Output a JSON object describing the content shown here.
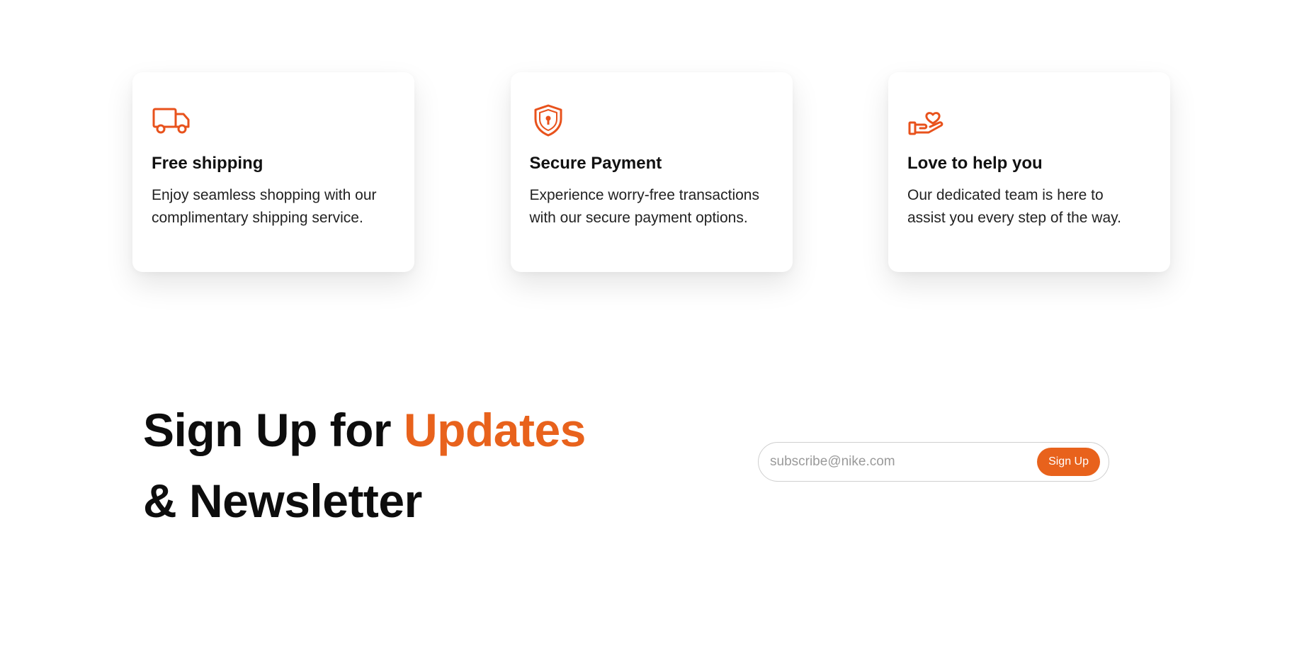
{
  "theme": {
    "accent_color": "#e8621c",
    "text_color": "#111111",
    "background": "#ffffff"
  },
  "services": [
    {
      "icon": "truck-icon",
      "title": "Free shipping",
      "text": "Enjoy seamless shopping with our complimentary shipping service."
    },
    {
      "icon": "shield-lock-icon",
      "title": "Secure Payment",
      "text": "Experience worry-free transactions with our secure payment options."
    },
    {
      "icon": "hand-heart-icon",
      "title": "Love to help you",
      "text": "Our dedicated team is here to assist you every step of the way."
    }
  ],
  "signup": {
    "title_part1": "Sign Up for ",
    "title_accent": "Updates",
    "title_line2": "& Newsletter",
    "input_placeholder": "subscribe@nike.com",
    "button_label": "Sign Up"
  }
}
